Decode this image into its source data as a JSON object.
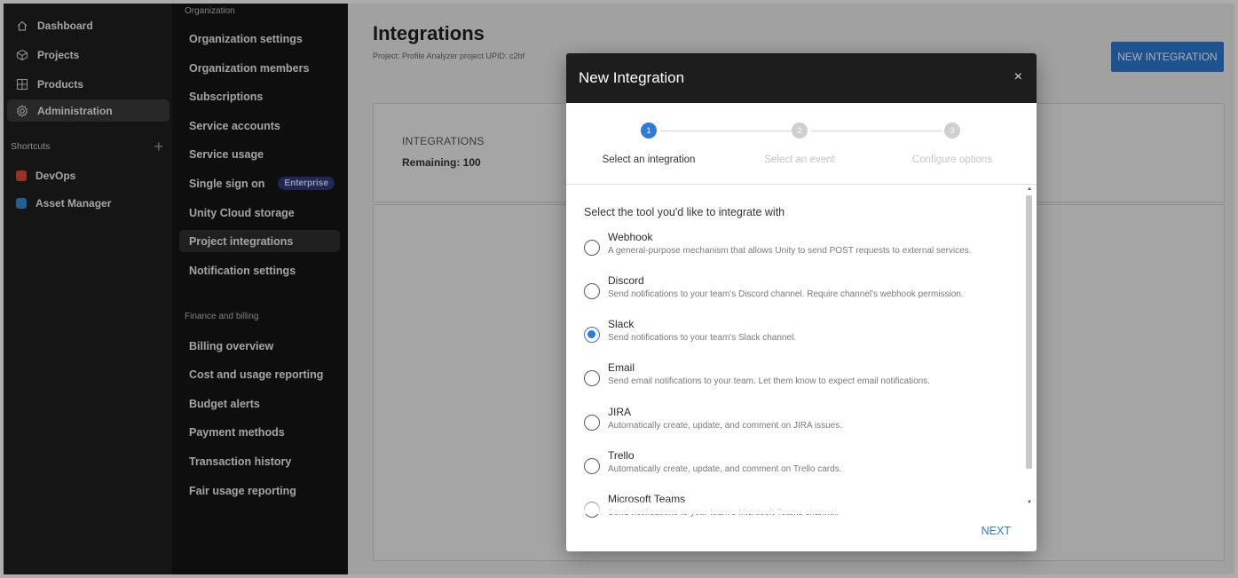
{
  "sidebar": {
    "items": [
      {
        "label": "Dashboard",
        "icon": "home-icon"
      },
      {
        "label": "Projects",
        "icon": "cube-icon"
      },
      {
        "label": "Products",
        "icon": "grid-icon"
      },
      {
        "label": "Administration",
        "icon": "gear-icon",
        "active": true
      }
    ],
    "shortcuts_label": "Shortcuts",
    "shortcuts_add": "+",
    "shortcuts": [
      {
        "label": "DevOps",
        "icon": "devops-icon",
        "color": "#e04a3a"
      },
      {
        "label": "Asset Manager",
        "icon": "asset-manager-icon",
        "color": "#2f8fd8"
      }
    ]
  },
  "subnav": {
    "org_section": "Organization",
    "org_items": [
      {
        "label": "Organization settings"
      },
      {
        "label": "Organization members"
      },
      {
        "label": "Subscriptions"
      },
      {
        "label": "Service accounts"
      },
      {
        "label": "Service usage"
      },
      {
        "label": "Single sign on",
        "badge": "Enterprise"
      },
      {
        "label": "Unity Cloud storage"
      },
      {
        "label": "Project integrations",
        "active": true
      },
      {
        "label": "Notification settings"
      }
    ],
    "finance_section": "Finance and billing",
    "finance_items": [
      {
        "label": "Billing overview"
      },
      {
        "label": "Cost and usage reporting"
      },
      {
        "label": "Budget alerts"
      },
      {
        "label": "Payment methods"
      },
      {
        "label": "Transaction history"
      },
      {
        "label": "Fair usage reporting"
      }
    ]
  },
  "main": {
    "title": "Integrations",
    "subtitle": "Project: Profile Analyzer project UPID: c2bf",
    "new_button": "NEW INTEGRATION",
    "card_label": "INTEGRATIONS",
    "remaining": "Remaining: 100"
  },
  "modal": {
    "title": "New Integration",
    "close": "×",
    "steps": [
      {
        "num": "1",
        "label": "Select an integration",
        "active": true
      },
      {
        "num": "2",
        "label": "Select an event",
        "active": false
      },
      {
        "num": "3",
        "label": "Configure options",
        "active": false
      }
    ],
    "list_title": "Select the tool you'd like to integrate with",
    "options": [
      {
        "name": "Webhook",
        "desc": "A general-purpose mechanism that allows Unity to send POST requests to external services.",
        "selected": false
      },
      {
        "name": "Discord",
        "desc": "Send notifications to your team's Discord channel. Require channel's webhook permission.",
        "selected": false
      },
      {
        "name": "Slack",
        "desc": "Send notifications to your team's Slack channel.",
        "selected": true
      },
      {
        "name": "Email",
        "desc": "Send email notifications to your team. Let them know to expect email notifications.",
        "selected": false
      },
      {
        "name": "JIRA",
        "desc": "Automatically create, update, and comment on JIRA issues.",
        "selected": false
      },
      {
        "name": "Trello",
        "desc": "Automatically create, update, and comment on Trello cards.",
        "selected": false
      },
      {
        "name": "Microsoft Teams",
        "desc": "Send notifications to your team's Microsoft Teams channel.",
        "selected": false
      }
    ],
    "next": "NEXT"
  }
}
